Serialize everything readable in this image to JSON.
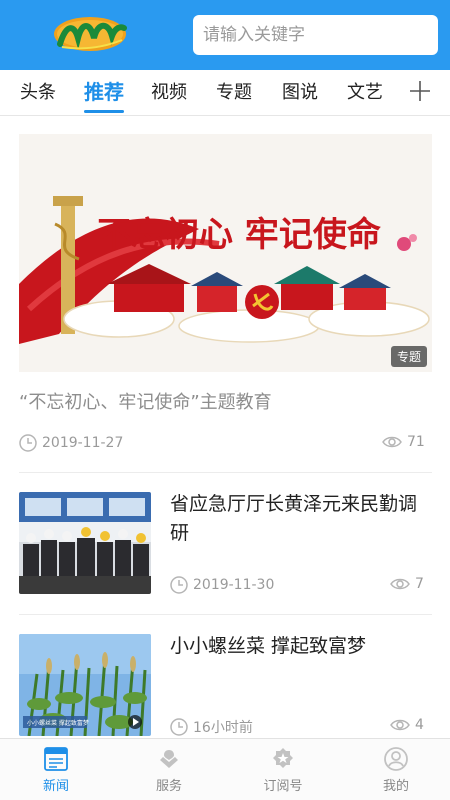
{
  "header": {
    "search_placeholder": "请输入关键字"
  },
  "tabs": [
    {
      "label": "头条"
    },
    {
      "label": "推荐",
      "active": true
    },
    {
      "label": "视频"
    },
    {
      "label": "专题"
    },
    {
      "label": "图说"
    },
    {
      "label": "文艺"
    }
  ],
  "featured": {
    "banner_text": "不忘初心 牢记使命",
    "badge": "专题",
    "title": "“不忘初心、牢记使命”主题教育",
    "date": "2019-11-27",
    "views": "71"
  },
  "articles": [
    {
      "title": "省应急厅厅长黄泽元来民勤调研",
      "date": "2019-11-30",
      "views": "7"
    },
    {
      "title": "小小螺丝菜  撑起致富梦",
      "date": "16小时前",
      "views": "4",
      "thumb_caption": "小小螺丝菜 撑起致富梦"
    }
  ],
  "bottom_nav": [
    {
      "label": "新闻",
      "icon": "news-icon",
      "active": true
    },
    {
      "label": "服务",
      "icon": "service-icon"
    },
    {
      "label": "订阅号",
      "icon": "subscribe-icon"
    },
    {
      "label": "我的",
      "icon": "profile-icon"
    }
  ],
  "colors": {
    "header_bg": "#2a9af0",
    "accent": "#1e8fe8",
    "banner_red": "#c8161d"
  }
}
